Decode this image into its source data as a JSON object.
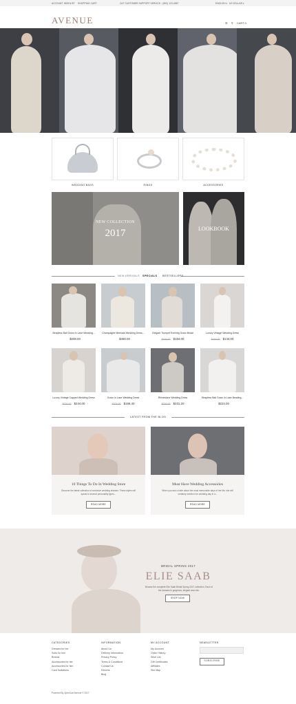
{
  "topbar": {
    "account": "ACCOUNT",
    "wishlist": "WISHLIST",
    "cart": "SHOPPING CART",
    "support": "24/7 CUSTOMER SUPPORT SERVICE - (800) 123-4567",
    "language": "ENGLISH ▾",
    "currency": "US DOLLAR ▾"
  },
  "header": {
    "logo": "AVENUE",
    "cart_label": "CART 0"
  },
  "categories": [
    {
      "label": "WEDDING BAGS"
    },
    {
      "label": "RINGS"
    },
    {
      "label": "ACCESSORIES"
    }
  ],
  "banners": {
    "collection_line1": "NEW COLLECTION",
    "collection_year": "2017",
    "lookbook": "LOOKBOOK"
  },
  "tabs": [
    "NEW ARRIVALS",
    "SPECIALS",
    "BESTSELLERS"
  ],
  "products": [
    {
      "name": "Strapless Ball Gown In Lace Wedding...",
      "old": "",
      "price": "$208.00"
    },
    {
      "name": "Champagne Mermaid Wedding Dress...",
      "old": "",
      "price": "$450.00"
    },
    {
      "name": "Elegant Trumpet Evening Gown Bridal",
      "old": "$209.00",
      "price": "$184.00"
    },
    {
      "name": "Luxury Vintage Wedding Dress",
      "old": "$189.00",
      "price": "$144.00"
    },
    {
      "name": "Luxury Vintage Capped Wedding Dress",
      "old": "$335.00",
      "price": "$244.00"
    },
    {
      "name": "Gown In Lace Wedding Dress",
      "old": "$205.00",
      "price": "$166.40"
    },
    {
      "name": "Rhinestone Wedding Dress",
      "old": "$255.00",
      "price": "$231.20"
    },
    {
      "name": "Strapless Ball Gown In Lace Beading...",
      "old": "",
      "price": "$224.00"
    }
  ],
  "blog": {
    "heading": "LATEST FROM THE BLOG",
    "posts": [
      {
        "title": "10 Things To Do In Wedding Store",
        "text": "Discover the latest collection of exclusive wedding dresses. These styles will speak to several personality types...",
        "button": "READ MORE"
      },
      {
        "title": "Must Have Wedding Accessories",
        "text": "When you ask a bride about the most memorable days of her life, she will certainly mention her wedding day in a...",
        "button": "READ MORE"
      }
    ]
  },
  "feature": {
    "kicker": "BRIDAL SPRING 2017",
    "title": "ELIE SAAB",
    "text": "Browse the complete Elie Saab Bridal Spring 2017 collection. Each of the dresses is gorgeous, elegant and chic.",
    "button": "SHOP NOW"
  },
  "footer": {
    "categories": {
      "heading": "CATEGORIES",
      "items": [
        "Dresses for her",
        "Suits for him",
        "Brands",
        "Accessories for her",
        "Accessories for him",
        "Card Invitations"
      ]
    },
    "information": {
      "heading": "INFORMATION",
      "items": [
        "About Us",
        "Delivery Information",
        "Privacy Policy",
        "Terms & Conditions",
        "Contact Us",
        "Returns",
        "Blog"
      ]
    },
    "account": {
      "heading": "MY ACCOUNT",
      "items": [
        "My Account",
        "Order History",
        "Wish List",
        "Gift Certificates",
        "Affiliates",
        "Site Map"
      ]
    },
    "newsletter": {
      "heading": "NEWSLETTER",
      "placeholder": "",
      "button": "SUBSCRIBE"
    },
    "copyright": "Powered By OpenCart Avenue © 2017"
  }
}
